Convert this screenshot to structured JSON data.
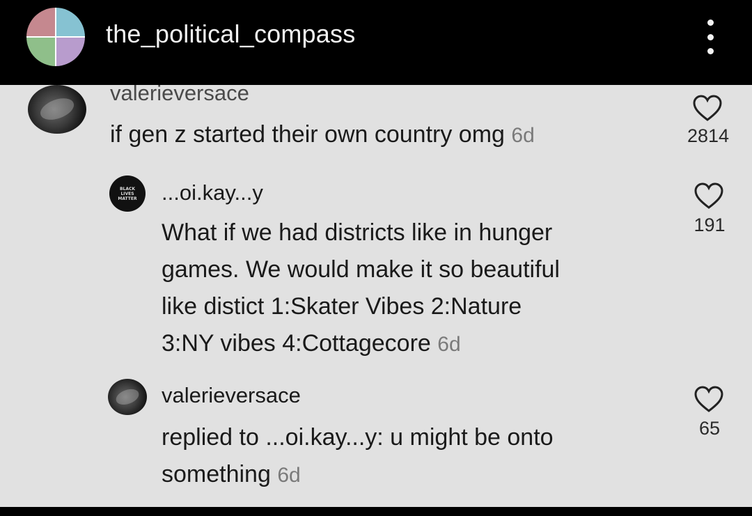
{
  "header": {
    "channel_name": "the_political_compass",
    "avatar_icon": "political-compass-logo",
    "more_icon": "more-vertical-icon",
    "quadrant_colors": [
      "#c5888f",
      "#86c2d2",
      "#8fbf8a",
      "#b89ccd"
    ]
  },
  "comments": [
    {
      "username": "valerieversace",
      "text": "if gen z started their own country omg",
      "time": "6d",
      "likes": "2814"
    },
    {
      "username": "...oi.kay...y",
      "avatar_text": [
        "BLACK",
        "LIVES",
        "MATTER"
      ],
      "text_lines": [
        "What if we had districts like in hunger",
        "games. We would make it so beautiful",
        "like distict 1:Skater Vibes 2:Nature",
        "3:NY vibes 4:Cottagecore"
      ],
      "time": "6d",
      "likes": "191"
    },
    {
      "username": "valerieversace",
      "text_lines": [
        "replied to ...oi.kay...y: u might be onto",
        "something"
      ],
      "time": "6d",
      "likes": "65"
    }
  ]
}
